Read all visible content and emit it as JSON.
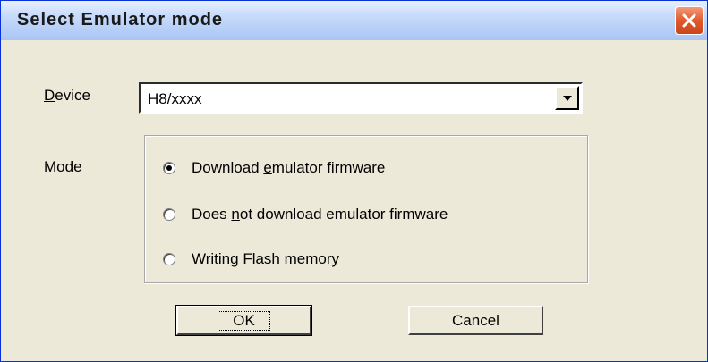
{
  "window": {
    "title": "Select Emulator mode",
    "close_label": "×"
  },
  "device": {
    "label_prefix": "",
    "label_mnemonic": "D",
    "label_rest": "evice",
    "selected_value": "H8/xxxx"
  },
  "mode": {
    "label": "Mode",
    "options": [
      {
        "pre": "Download ",
        "mnemonic": "e",
        "post": "mulator firmware",
        "selected": true
      },
      {
        "pre": "Does ",
        "mnemonic": "n",
        "post": "ot download emulator firmware",
        "selected": false
      },
      {
        "pre": "Writing ",
        "mnemonic": "F",
        "post": "lash memory",
        "selected": false
      }
    ]
  },
  "buttons": {
    "ok": "OK",
    "cancel": "Cancel"
  },
  "colors": {
    "dialog_bg": "#ece9d8",
    "title_gradient_top": "#e8f0ff",
    "close_red": "#e05a2a"
  },
  "icons": {
    "close": "close-icon",
    "dropdown": "chevron-down-icon"
  }
}
